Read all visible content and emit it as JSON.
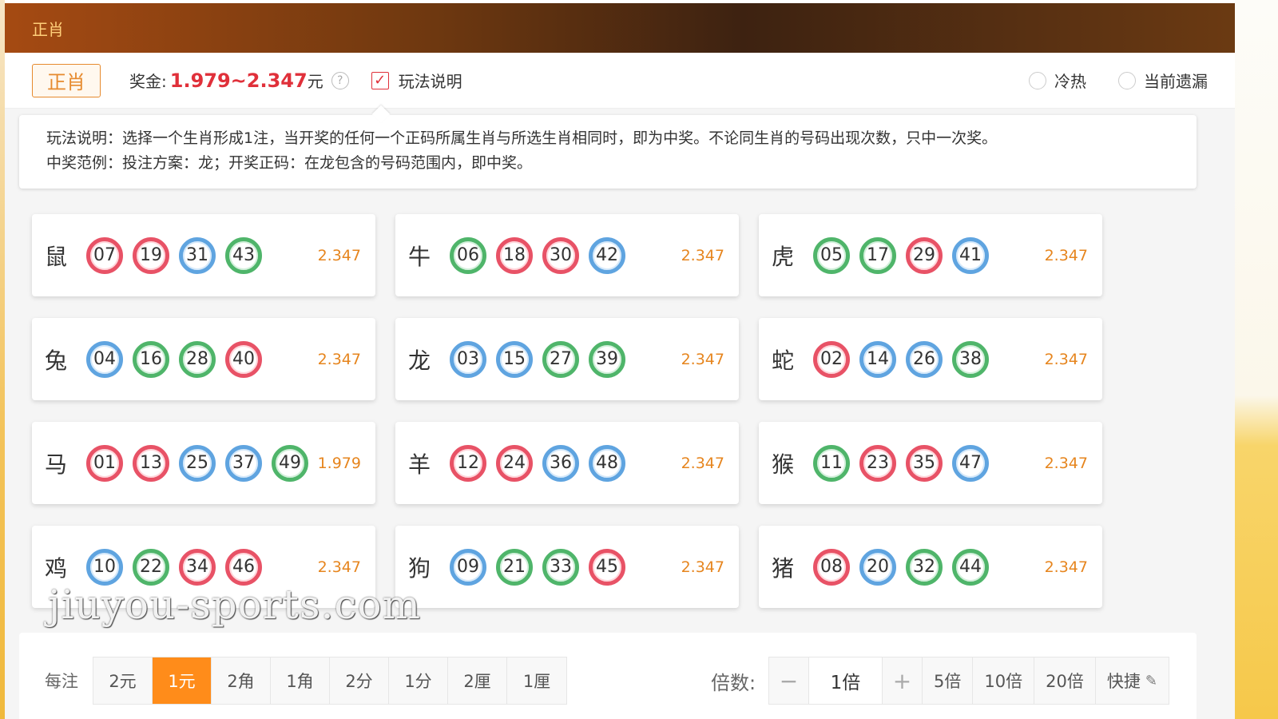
{
  "header": {
    "title": "正肖"
  },
  "playbar": {
    "play_button": "正肖",
    "bonus_label": "奖金:",
    "bonus_value": "1.979~2.347",
    "bonus_unit": "元",
    "help_icon": "?",
    "checkbox_mark": "✓",
    "rules_toggle_label": "玩法说明",
    "radio_hot_cold": "冷热",
    "radio_missing": "当前遗漏"
  },
  "description": {
    "line1": "玩法说明：选择一个生肖形成1注，当开奖的任何一个正码所属生肖与所选生肖相同时，即为中奖。不论同生肖的号码出现次数，只中一次奖。",
    "line2": "中奖范例：投注方案：龙；开奖正码：在龙包含的号码范围内，即中奖。"
  },
  "zodiacs": [
    {
      "name": "鼠",
      "odds": "2.347",
      "balls": [
        {
          "n": "07",
          "c": "red"
        },
        {
          "n": "19",
          "c": "red"
        },
        {
          "n": "31",
          "c": "blue"
        },
        {
          "n": "43",
          "c": "green"
        }
      ]
    },
    {
      "name": "牛",
      "odds": "2.347",
      "balls": [
        {
          "n": "06",
          "c": "green"
        },
        {
          "n": "18",
          "c": "red"
        },
        {
          "n": "30",
          "c": "red"
        },
        {
          "n": "42",
          "c": "blue"
        }
      ]
    },
    {
      "name": "虎",
      "odds": "2.347",
      "balls": [
        {
          "n": "05",
          "c": "green"
        },
        {
          "n": "17",
          "c": "green"
        },
        {
          "n": "29",
          "c": "red"
        },
        {
          "n": "41",
          "c": "blue"
        }
      ]
    },
    {
      "name": "兔",
      "odds": "2.347",
      "balls": [
        {
          "n": "04",
          "c": "blue"
        },
        {
          "n": "16",
          "c": "green"
        },
        {
          "n": "28",
          "c": "green"
        },
        {
          "n": "40",
          "c": "red"
        }
      ]
    },
    {
      "name": "龙",
      "odds": "2.347",
      "balls": [
        {
          "n": "03",
          "c": "blue"
        },
        {
          "n": "15",
          "c": "blue"
        },
        {
          "n": "27",
          "c": "green"
        },
        {
          "n": "39",
          "c": "green"
        }
      ]
    },
    {
      "name": "蛇",
      "odds": "2.347",
      "balls": [
        {
          "n": "02",
          "c": "red"
        },
        {
          "n": "14",
          "c": "blue"
        },
        {
          "n": "26",
          "c": "blue"
        },
        {
          "n": "38",
          "c": "green"
        }
      ]
    },
    {
      "name": "马",
      "odds": "1.979",
      "balls": [
        {
          "n": "01",
          "c": "red"
        },
        {
          "n": "13",
          "c": "red"
        },
        {
          "n": "25",
          "c": "blue"
        },
        {
          "n": "37",
          "c": "blue"
        },
        {
          "n": "49",
          "c": "green"
        }
      ]
    },
    {
      "name": "羊",
      "odds": "2.347",
      "balls": [
        {
          "n": "12",
          "c": "red"
        },
        {
          "n": "24",
          "c": "red"
        },
        {
          "n": "36",
          "c": "blue"
        },
        {
          "n": "48",
          "c": "blue"
        }
      ]
    },
    {
      "name": "猴",
      "odds": "2.347",
      "balls": [
        {
          "n": "11",
          "c": "green"
        },
        {
          "n": "23",
          "c": "red"
        },
        {
          "n": "35",
          "c": "red"
        },
        {
          "n": "47",
          "c": "blue"
        }
      ]
    },
    {
      "name": "鸡",
      "odds": "2.347",
      "balls": [
        {
          "n": "10",
          "c": "blue"
        },
        {
          "n": "22",
          "c": "green"
        },
        {
          "n": "34",
          "c": "red"
        },
        {
          "n": "46",
          "c": "red"
        }
      ]
    },
    {
      "name": "狗",
      "odds": "2.347",
      "balls": [
        {
          "n": "09",
          "c": "blue"
        },
        {
          "n": "21",
          "c": "green"
        },
        {
          "n": "33",
          "c": "green"
        },
        {
          "n": "45",
          "c": "red"
        }
      ]
    },
    {
      "name": "猪",
      "odds": "2.347",
      "balls": [
        {
          "n": "08",
          "c": "red"
        },
        {
          "n": "20",
          "c": "blue"
        },
        {
          "n": "32",
          "c": "green"
        },
        {
          "n": "44",
          "c": "green"
        }
      ]
    }
  ],
  "bet_unit": {
    "label": "每注",
    "options": [
      "2元",
      "1元",
      "2角",
      "1角",
      "2分",
      "1分",
      "2厘",
      "1厘"
    ],
    "selected": "1元"
  },
  "multiplier": {
    "label": "倍数:",
    "minus": "−",
    "value": "1倍",
    "plus": "+",
    "presets": [
      "5倍",
      "10倍",
      "20倍"
    ],
    "quick_label": "快捷",
    "quick_icon": "✎"
  },
  "watermark": "jiuyou-sports.com",
  "colors": {
    "accent": "#ff8c1a",
    "bonus_red": "#e0303a",
    "odds_orange": "#e6851e",
    "ball_red": "#e85266",
    "ball_blue": "#5fa4e0",
    "ball_green": "#4fb56a"
  }
}
